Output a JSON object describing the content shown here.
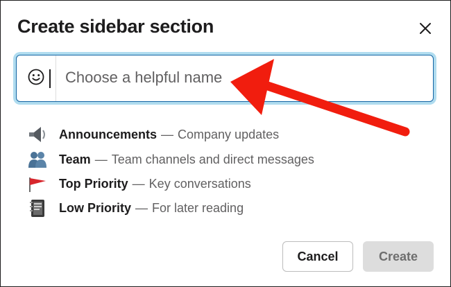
{
  "dialog": {
    "title": "Create sidebar section",
    "close_icon": "close-icon"
  },
  "name_input": {
    "placeholder": "Choose a helpful name",
    "value": "",
    "emoji_icon": "smiley-face-icon"
  },
  "suggestions": [
    {
      "icon": "loudspeaker-icon",
      "name": "Announcements",
      "separator": "—",
      "description": "Company updates"
    },
    {
      "icon": "people-icon",
      "name": "Team",
      "separator": "—",
      "description": "Team channels and direct messages"
    },
    {
      "icon": "red-flag-icon",
      "name": "Top Priority",
      "separator": "—",
      "description": "Key conversations"
    },
    {
      "icon": "notebook-icon",
      "name": "Low Priority",
      "separator": "—",
      "description": "For later reading"
    }
  ],
  "buttons": {
    "cancel_label": "Cancel",
    "create_label": "Create",
    "create_enabled": false
  },
  "annotation": {
    "arrow_color": "#f11d0e"
  },
  "colors": {
    "focus_ring": "#1d9bd1",
    "focus_border": "#1264a3",
    "text": "#1d1c1d",
    "muted_text": "#616061",
    "disabled_button": "#dddddd"
  }
}
